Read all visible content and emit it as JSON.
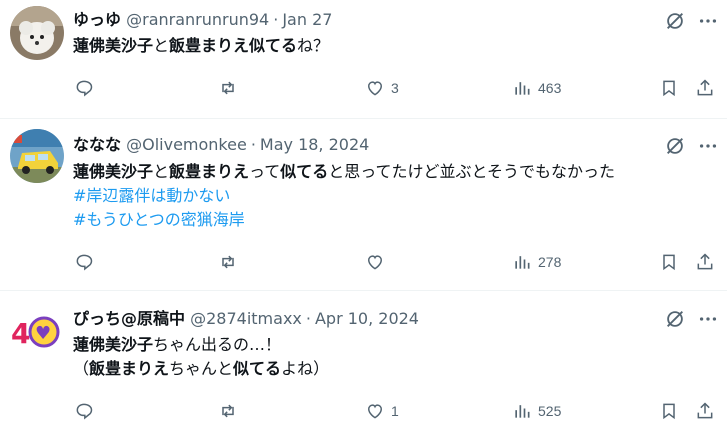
{
  "posts": [
    {
      "name": "ゆっゆ",
      "handle": "@ranranrunrun94",
      "date": "Jan 27",
      "text": [
        {
          "t": "蓮佛美沙子",
          "b": true
        },
        {
          "t": "と",
          "b": false
        },
        {
          "t": "飯豊まりえ似てる",
          "b": true
        },
        {
          "t": "ね？",
          "b": false
        }
      ],
      "hashtags": [],
      "replies": "",
      "reposts": "",
      "likes": "3",
      "views": "463"
    },
    {
      "name": "ななな",
      "handle": "@Olivemonkee",
      "date": "May 18, 2024",
      "text": [
        {
          "t": "蓮佛美沙子",
          "b": true
        },
        {
          "t": "と",
          "b": false
        },
        {
          "t": "飯豊まりえ",
          "b": true
        },
        {
          "t": "って",
          "b": false
        },
        {
          "t": "似てる",
          "b": true
        },
        {
          "t": "と思ってたけど並ぶとそうでもなかった",
          "b": false
        }
      ],
      "hashtags": [
        "#岸辺露伴は動かない",
        "#もうひとつの密猟海岸"
      ],
      "replies": "",
      "reposts": "",
      "likes": "",
      "views": "278"
    },
    {
      "name": "ぴっち@原稿中",
      "handle": "@2874itmaxx",
      "date": "Apr 10, 2024",
      "line1": [
        {
          "t": "蓮佛美沙子",
          "b": true
        },
        {
          "t": "ちゃん出るの…！",
          "b": false
        }
      ],
      "line2": [
        {
          "t": "（",
          "b": false
        },
        {
          "t": "飯豊まりえ",
          "b": true
        },
        {
          "t": "ちゃんと",
          "b": false
        },
        {
          "t": "似てる",
          "b": true
        },
        {
          "t": "よね）",
          "b": false
        }
      ],
      "hashtags": [],
      "replies": "",
      "reposts": "",
      "likes": "1",
      "views": "525"
    }
  ],
  "icons": {
    "reply": "reply-icon",
    "repost": "repost-icon",
    "like": "heart-icon",
    "views": "views-icon",
    "bookmark": "bookmark-icon",
    "share": "share-icon",
    "grok": "grok-icon",
    "more": "more-icon"
  },
  "colors": {
    "text": "#0f1419",
    "secondary": "#536471",
    "link": "#1d9bf0",
    "divider": "#eff3f4"
  }
}
